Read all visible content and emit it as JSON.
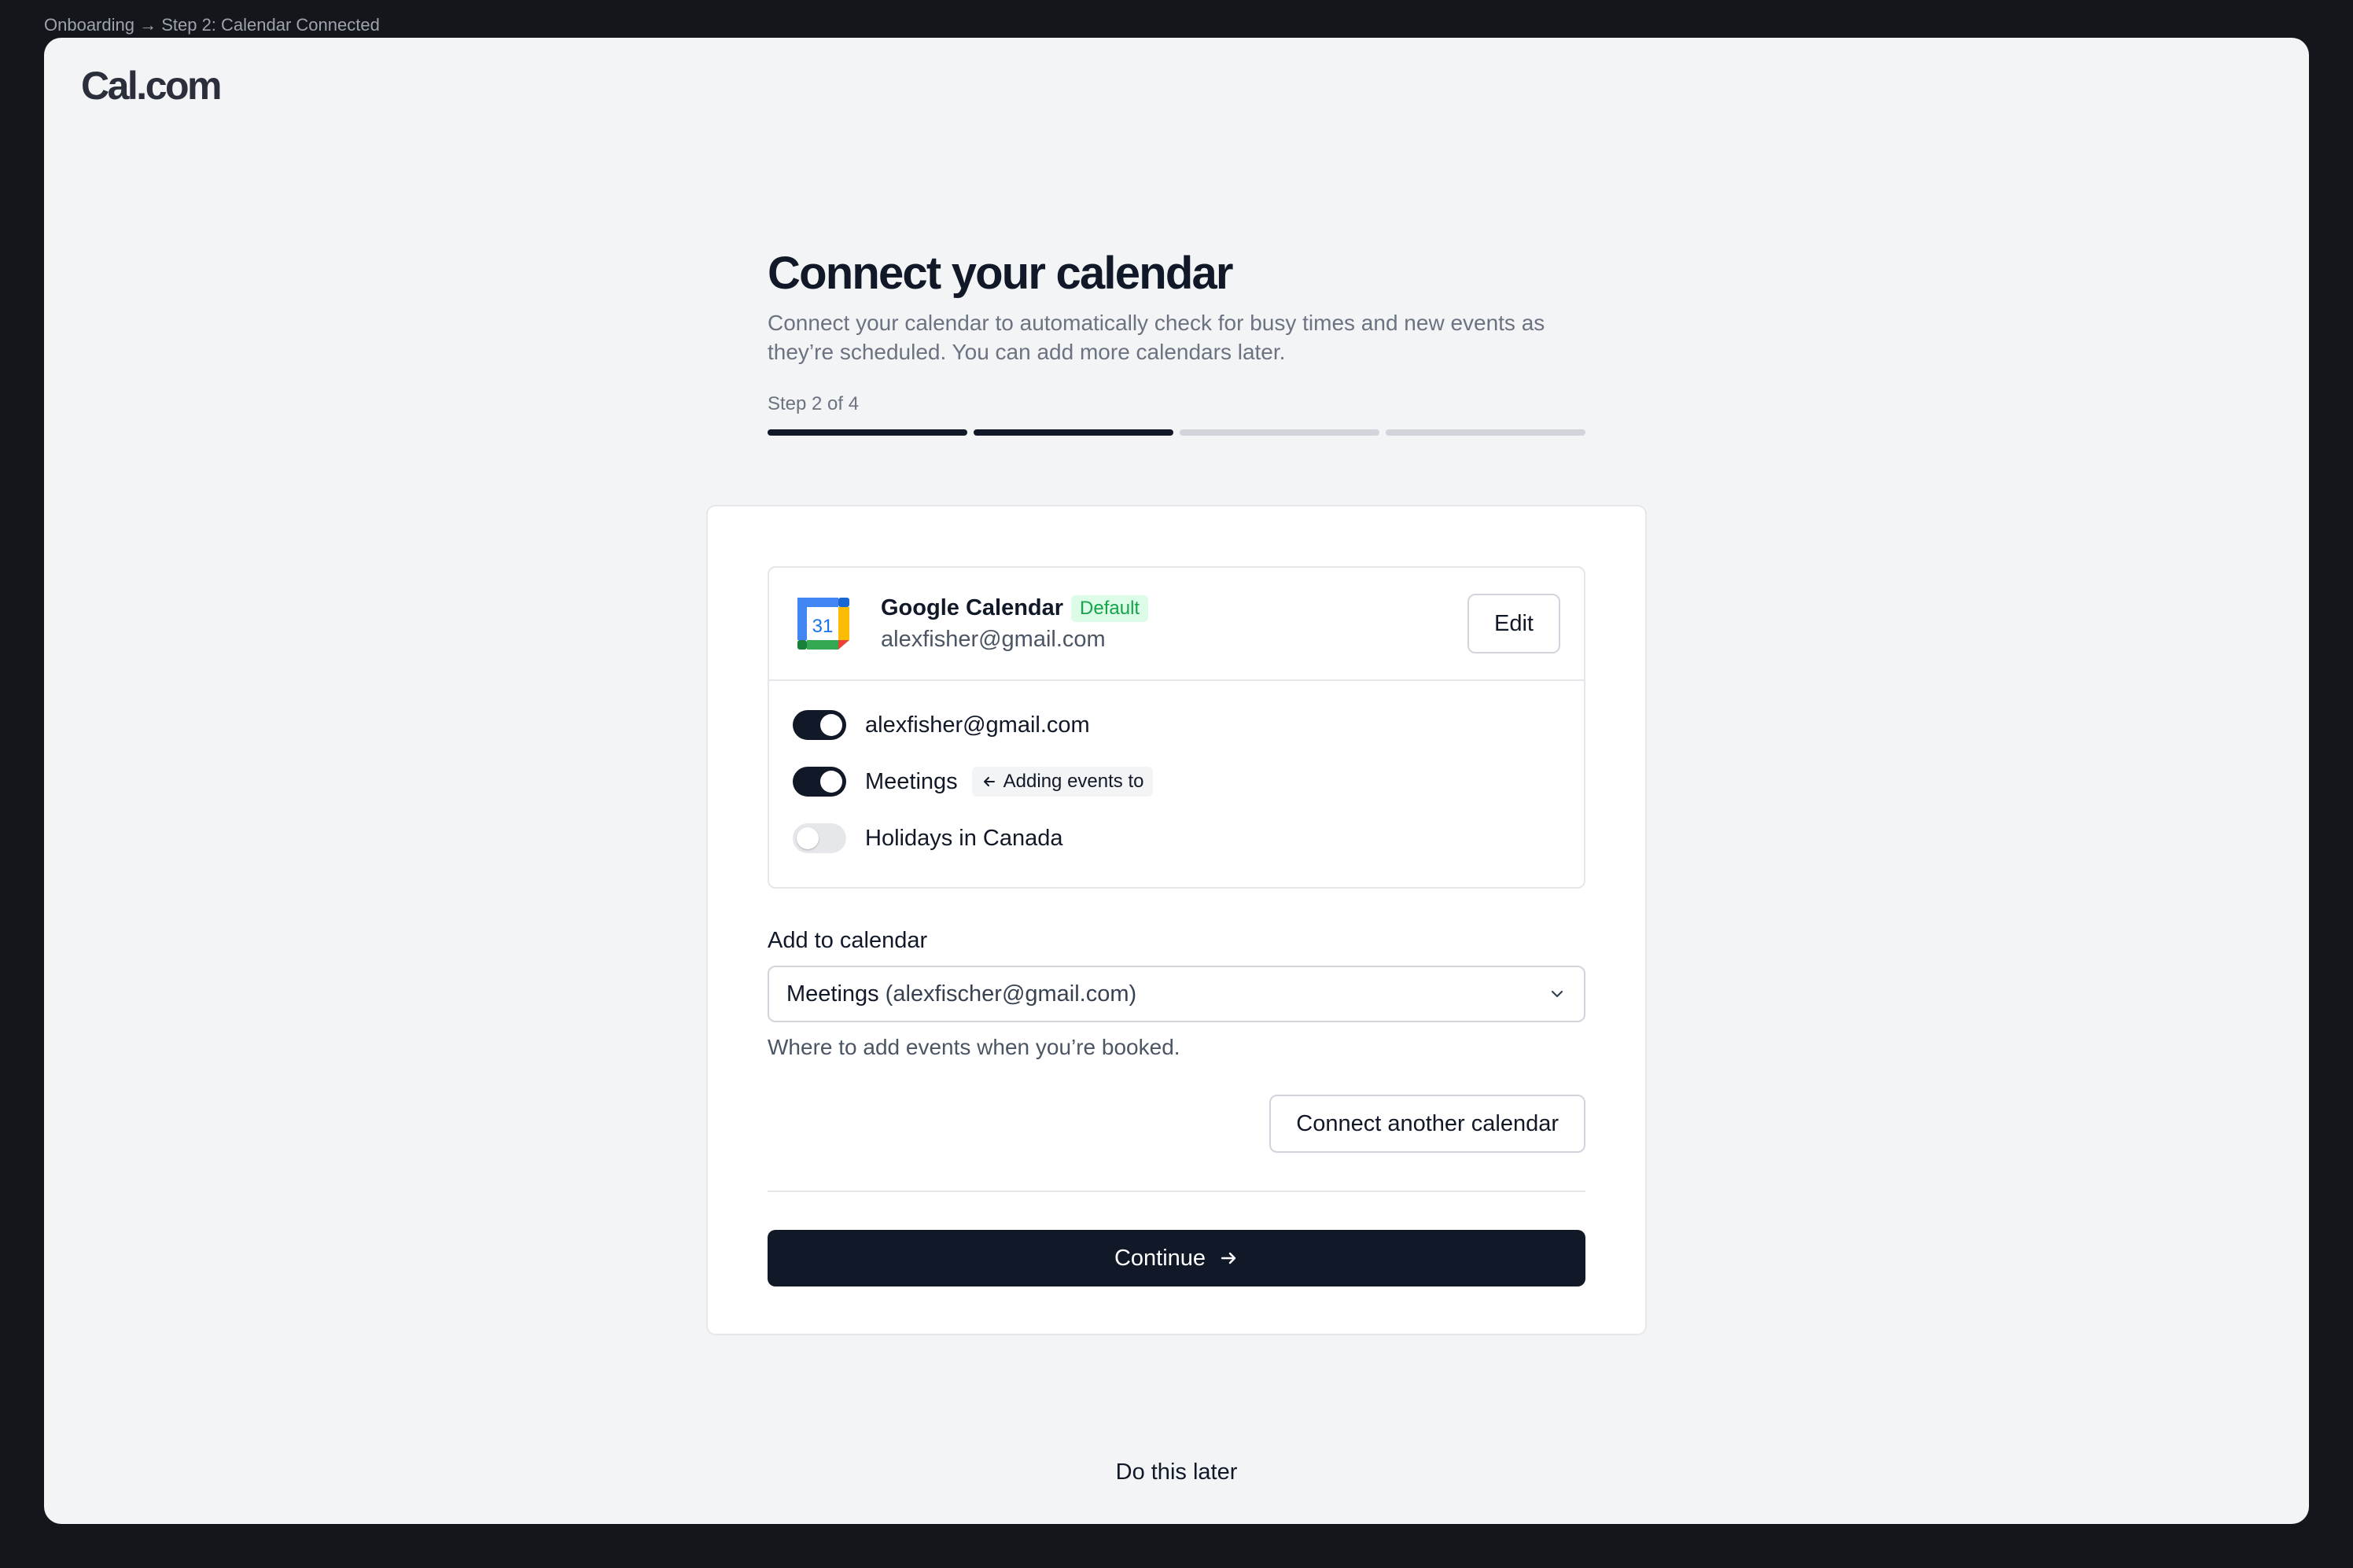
{
  "breadcrumb": "Onboarding → Step 2: Calendar Connected",
  "brand": {
    "logo_text": "Cal.com"
  },
  "header": {
    "title": "Connect your calendar",
    "subtitle": "Connect your calendar to automatically check for busy times and new events as they’re scheduled. You can add more calendars later."
  },
  "progress": {
    "label": "Step 2 of 4",
    "current": 2,
    "total": 4
  },
  "calendar": {
    "icon": "google-calendar-icon",
    "icon_day": "31",
    "name": "Google Calendar",
    "badge": "Default",
    "email": "alexfisher@gmail.com",
    "edit_label": "Edit",
    "items": [
      {
        "label": "alexfisher@gmail.com",
        "enabled": true
      },
      {
        "label": "Meetings",
        "enabled": true,
        "badge": "Adding events to"
      },
      {
        "label": "Holidays in Canada",
        "enabled": false
      }
    ]
  },
  "destination": {
    "label": "Add to calendar",
    "selected_main": "Meetings",
    "selected_sub": "(alexfischer@gmail.com)",
    "hint": "Where to add events when you’re booked."
  },
  "actions": {
    "connect_another": "Connect another calendar",
    "continue": "Continue",
    "skip": "Do this later"
  },
  "colors": {
    "background": "#14161b",
    "panel": "#f3f4f6",
    "primary": "#111827",
    "default_badge_bg": "#dcfce7",
    "default_badge_text": "#16a34a"
  }
}
